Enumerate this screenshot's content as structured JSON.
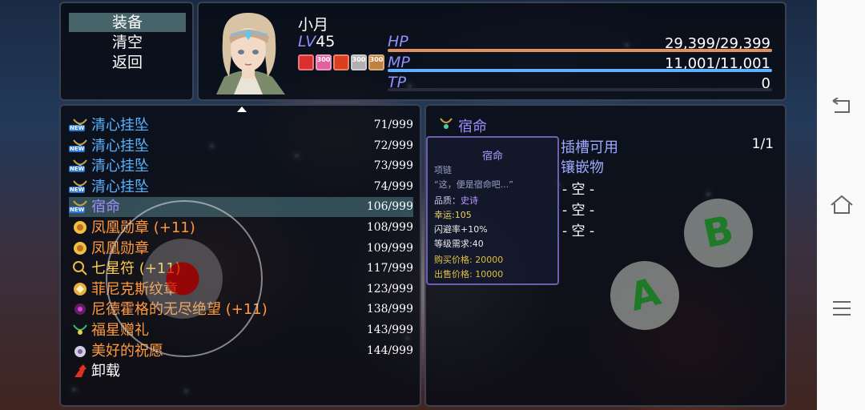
{
  "commands": [
    {
      "label": "装备",
      "selected": true
    },
    {
      "label": "清空",
      "selected": false
    },
    {
      "label": "返回",
      "selected": false
    }
  ],
  "actor": {
    "name": "小月",
    "level_label": "LV",
    "level": "45",
    "hp_label": "HP",
    "hp_value": "29,399/29,399",
    "hp_ratio": 1.0,
    "mp_label": "MP",
    "mp_value": "11,001/11,001",
    "mp_ratio": 1.0,
    "tp_label": "TP",
    "tp_value": "0",
    "tp_ratio": 0.0,
    "state_icons": [
      {
        "icon": "flame-rune-icon",
        "badge": ""
      },
      {
        "icon": "pink-rune-icon",
        "badge": "300"
      },
      {
        "icon": "spiral-rune-icon",
        "badge": ""
      },
      {
        "icon": "skull-rune-icon",
        "badge": "300"
      },
      {
        "icon": "gauntlet-rune-icon",
        "badge": "300"
      }
    ]
  },
  "items": [
    {
      "name": "清心挂坠",
      "count": "71/999",
      "color": "#58b4ff",
      "icon": "pendant-icon",
      "new": true,
      "new_label": "NEW"
    },
    {
      "name": "清心挂坠",
      "count": "72/999",
      "color": "#58b4ff",
      "icon": "pendant-icon",
      "new": true,
      "new_label": "NEW"
    },
    {
      "name": "清心挂坠",
      "count": "73/999",
      "color": "#58b4ff",
      "icon": "pendant-icon",
      "new": true,
      "new_label": "NEW"
    },
    {
      "name": "清心挂坠",
      "count": "74/999",
      "color": "#58b4ff",
      "icon": "pendant-icon",
      "new": true,
      "new_label": "NEW"
    },
    {
      "name": "宿命",
      "count": "106/999",
      "color": "#9f8cff",
      "icon": "necklace-icon",
      "new": true,
      "new_label": "NEW",
      "selected": true
    },
    {
      "name": "凤凰勋章 (+11)",
      "count": "108/999",
      "color": "#ff9a3c",
      "icon": "phoenix-medal-icon",
      "new": false
    },
    {
      "name": "凤凰勋章",
      "count": "109/999",
      "color": "#ff9a3c",
      "icon": "phoenix-medal-icon",
      "new": false
    },
    {
      "name": "七星符 (+11)",
      "count": "117/999",
      "color": "#ffcf4a",
      "icon": "seven-star-charm-icon",
      "new": false
    },
    {
      "name": "菲尼克斯纹章",
      "count": "123/999",
      "color": "#ff9a3c",
      "icon": "crest-icon",
      "new": false
    },
    {
      "name": "尼德霍格的无尽绝望 (+11)",
      "count": "138/999",
      "color": "#ff9a3c",
      "icon": "dragon-orb-icon",
      "new": false
    },
    {
      "name": "福星赠礼",
      "count": "143/999",
      "color": "#ff9a3c",
      "icon": "lucky-gift-icon",
      "new": false
    },
    {
      "name": "美好的祝愿",
      "count": "144/999",
      "color": "#ff9a3c",
      "icon": "wish-icon",
      "new": false
    },
    {
      "name": "卸载",
      "count": "",
      "color": "#ffffff",
      "icon": "unequip-arrow-icon",
      "new": false
    }
  ],
  "detail": {
    "header": "宿命",
    "header_color": "#9f8cff",
    "tooltip": {
      "title": "宿命",
      "type": "项链",
      "quote": "“这，便是宿命吧...”",
      "quality_label": "品质：",
      "quality": "史诗",
      "luck": "幸运:105",
      "evade": "闪避率+10%",
      "req_level": "等级需求:40",
      "buy_label": "购买价格:",
      "buy": "20000",
      "sell_label": "出售价格:",
      "sell": "10000"
    },
    "slots_label": "插槽可用",
    "slots_value": "1/1",
    "inlay_label": "镶嵌物",
    "empty_slots": [
      "- 空 -",
      "- 空 -",
      "- 空 -"
    ]
  },
  "controls": {
    "a_label": "A",
    "b_label": "B"
  },
  "nav": {
    "back_icon": "back-icon",
    "home_icon": "home-icon",
    "menu_icon": "menu-icon"
  },
  "colors": {
    "hp": "#e0905a",
    "mp": "#60b0ff",
    "tp": "#4aa0ff",
    "selection": "#5a8c96"
  }
}
